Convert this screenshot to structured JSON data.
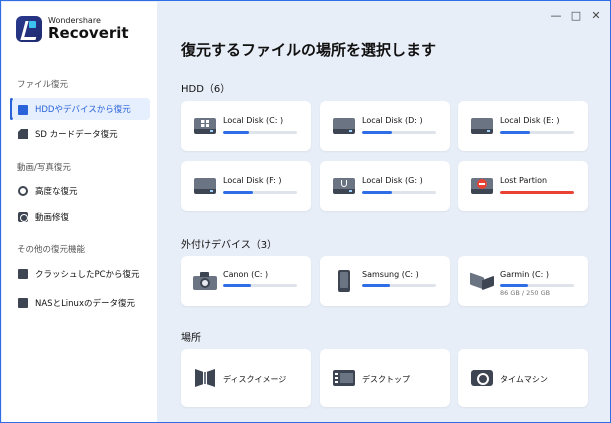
{
  "app": {
    "brand_small": "Wondershare",
    "brand_big": "Recoverit"
  },
  "window_controls": {
    "minimize": "—",
    "maximize": "□",
    "close": "✕"
  },
  "sidebar": {
    "groups": [
      {
        "title": "ファイル復元",
        "items": [
          {
            "label": "HDDやデバイスから復元",
            "icon": "hdd-icon",
            "active": true
          },
          {
            "label": "SD カードデータ復元",
            "icon": "sd-card-icon",
            "active": false
          }
        ]
      },
      {
        "title": "動画/写真復元",
        "items": [
          {
            "label": "高度な復元",
            "icon": "advanced-recovery-icon",
            "active": false
          },
          {
            "label": "動画修復",
            "icon": "video-repair-icon",
            "active": false
          }
        ]
      },
      {
        "title": "その他の復元機能",
        "items": [
          {
            "label": "クラッシュしたPCから復元",
            "icon": "crashed-pc-icon",
            "active": false
          },
          {
            "label": "NASとLinuxのデータ復元",
            "icon": "nas-icon",
            "active": false
          }
        ]
      }
    ]
  },
  "main": {
    "title": "復元するファイルの場所を選択します",
    "hdd_section": {
      "title": "HDD（6）",
      "disks": [
        {
          "label": "Local Disk (C: )",
          "icon": "windows-disk-icon",
          "fill": 0.35,
          "color": "#2f6de6"
        },
        {
          "label": "Local Disk (D: )",
          "icon": "disk-icon",
          "fill": 0.4,
          "color": "#2f6de6"
        },
        {
          "label": "Local Disk (E: )",
          "icon": "disk-icon",
          "fill": 0.4,
          "color": "#2f6de6"
        },
        {
          "label": "Local Disk (F: )",
          "icon": "disk-icon",
          "fill": 0.4,
          "color": "#2f6de6"
        },
        {
          "label": "Local Disk (G: )",
          "icon": "usb-disk-icon",
          "fill": 0.4,
          "color": "#2f6de6"
        },
        {
          "label": "Lost Partion",
          "icon": "lost-partition-icon",
          "fill": 1.0,
          "color": "#e94235"
        }
      ]
    },
    "external_section": {
      "title": "外付けデバイス（3）",
      "devices": [
        {
          "label": "Canon (C: )",
          "icon": "camera-icon",
          "fill": 0.38,
          "sub": ""
        },
        {
          "label": "Samsung (C: )",
          "icon": "phone-icon",
          "fill": 0.38,
          "sub": ""
        },
        {
          "label": "Garmin (C: )",
          "icon": "garmin-device-icon",
          "fill": 0.38,
          "sub": "86 GB / 250 GB"
        }
      ]
    },
    "location_section": {
      "title": "場所",
      "locations": [
        {
          "label": "ディスクイメージ",
          "icon": "disk-image-icon"
        },
        {
          "label": "デスクトップ",
          "icon": "desktop-icon"
        },
        {
          "label": "タイムマシン",
          "icon": "time-machine-icon"
        }
      ]
    }
  },
  "colors": {
    "accent": "#2f6de6",
    "danger": "#e94235",
    "sidebar_active_bg": "#e6effd"
  }
}
